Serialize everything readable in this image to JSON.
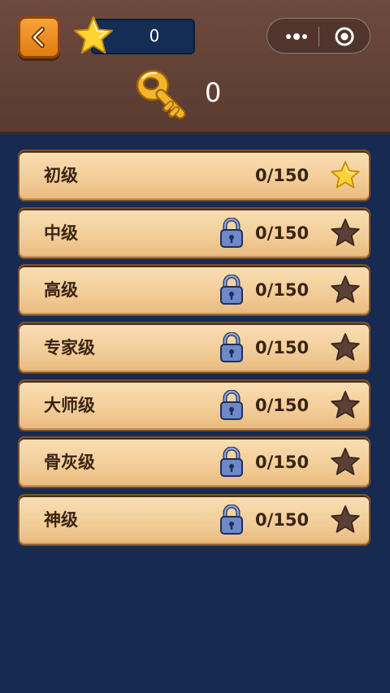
{
  "header": {
    "score": "0",
    "keys": "0",
    "back_icon": "chevron-left-icon",
    "score_icon": "star-icon",
    "key_icon": "key-icon",
    "capsule": {
      "more_icon": "more-dots-icon",
      "close_icon": "target-close-icon"
    }
  },
  "levels": [
    {
      "name": "初级",
      "progress": "0/150",
      "locked": false,
      "star": "gold"
    },
    {
      "name": "中级",
      "progress": "0/150",
      "locked": true,
      "star": "dark"
    },
    {
      "name": "高级",
      "progress": "0/150",
      "locked": true,
      "star": "dark"
    },
    {
      "name": "专家级",
      "progress": "0/150",
      "locked": true,
      "star": "dark"
    },
    {
      "name": "大师级",
      "progress": "0/150",
      "locked": true,
      "star": "dark"
    },
    {
      "name": "骨灰级",
      "progress": "0/150",
      "locked": true,
      "star": "dark"
    },
    {
      "name": "神级",
      "progress": "0/150",
      "locked": true,
      "star": "dark"
    }
  ],
  "colors": {
    "background": "#172a52",
    "header": "#6d4a3d",
    "row": "#f2cc96",
    "gold_star": "#ffd23a",
    "dark_star": "#5a4036",
    "lock": "#6f88c8"
  }
}
